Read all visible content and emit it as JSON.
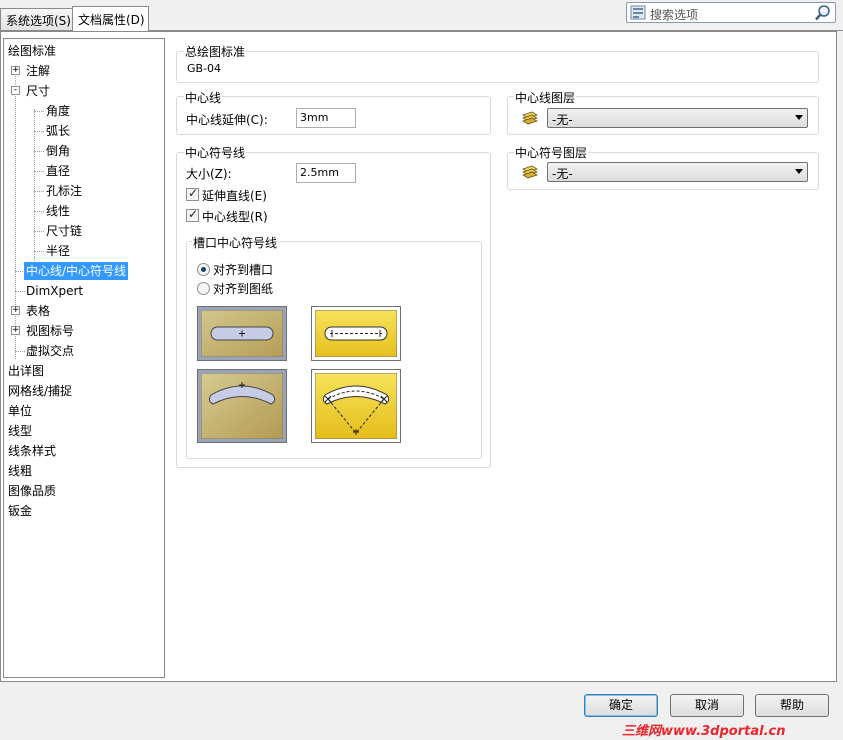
{
  "tabs": [
    {
      "label": "系统选项(S)",
      "active": false
    },
    {
      "label": "文档属性(D)",
      "active": true
    }
  ],
  "search": {
    "placeholder": "搜索选项"
  },
  "tree": [
    {
      "label": "绘图标准",
      "level": 0,
      "expander": ""
    },
    {
      "label": "注解",
      "level": 1,
      "expander": "+"
    },
    {
      "label": "尺寸",
      "level": 1,
      "expander": "-"
    },
    {
      "label": "角度",
      "level": 2,
      "expander": ""
    },
    {
      "label": "弧长",
      "level": 2,
      "expander": ""
    },
    {
      "label": "倒角",
      "level": 2,
      "expander": ""
    },
    {
      "label": "直径",
      "level": 2,
      "expander": ""
    },
    {
      "label": "孔标注",
      "level": 2,
      "expander": ""
    },
    {
      "label": "线性",
      "level": 2,
      "expander": ""
    },
    {
      "label": "尺寸链",
      "level": 2,
      "expander": ""
    },
    {
      "label": "半径",
      "level": 2,
      "expander": ""
    },
    {
      "label": "中心线/中心符号线",
      "level": 1,
      "expander": "",
      "selected": true
    },
    {
      "label": "DimXpert",
      "level": 1,
      "expander": ""
    },
    {
      "label": "表格",
      "level": 1,
      "expander": "+"
    },
    {
      "label": "视图标号",
      "level": 1,
      "expander": "+"
    },
    {
      "label": "虚拟交点",
      "level": 1,
      "expander": ""
    },
    {
      "label": "出详图",
      "level": 0,
      "expander": ""
    },
    {
      "label": "网格线/捕捉",
      "level": 0,
      "expander": ""
    },
    {
      "label": "单位",
      "level": 0,
      "expander": ""
    },
    {
      "label": "线型",
      "level": 0,
      "expander": ""
    },
    {
      "label": "线条样式",
      "level": 0,
      "expander": ""
    },
    {
      "label": "线粗",
      "level": 0,
      "expander": ""
    },
    {
      "label": "图像品质",
      "level": 0,
      "expander": ""
    },
    {
      "label": "钣金",
      "level": 0,
      "expander": ""
    }
  ],
  "overall_standard": {
    "title": "总绘图标准",
    "value": "GB-04"
  },
  "centerline": {
    "title": "中心线",
    "extension_label": "中心线延伸(C):",
    "extension_value": "3mm"
  },
  "centerline_layer": {
    "title": "中心线图层",
    "value": "-无-"
  },
  "centermark": {
    "title": "中心符号线",
    "size_label": "大小(Z):",
    "size_value": "2.5mm",
    "extend_lines_label": "延伸直线(E)",
    "extend_lines_checked": true,
    "centerline_font_label": "中心线型(R)",
    "centerline_font_checked": true
  },
  "centermark_layer": {
    "title": "中心符号图层",
    "value": "-无-"
  },
  "slot": {
    "title": "槽口中心符号线",
    "align_slot_label": "对齐到槽口",
    "align_sheet_label": "对齐到图纸",
    "selected": "align_slot"
  },
  "buttons": {
    "ok": "确定",
    "cancel": "取消",
    "help": "帮助"
  },
  "watermark": "三维网www.3dportal.cn",
  "colors": {
    "selection": "#3399ff",
    "slot_fill": "#f1d23a",
    "watermark": "#e8262d"
  }
}
